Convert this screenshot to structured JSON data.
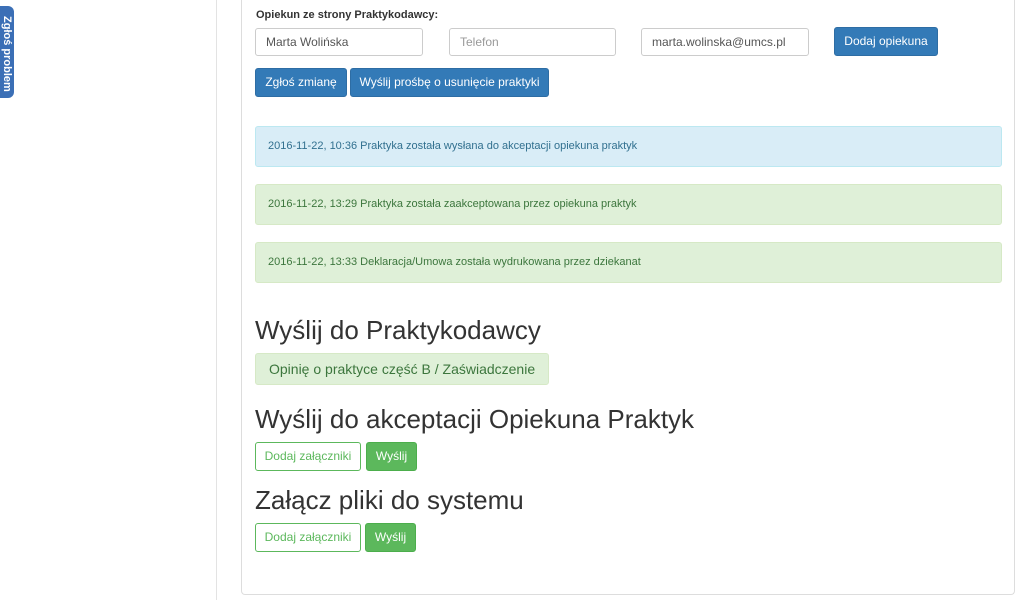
{
  "report_tab": {
    "label": "Zgłoś problem"
  },
  "guardian": {
    "label": "Opiekun ze strony Praktykodawcy:",
    "name_value": "Marta Wolińska",
    "phone_placeholder": "Telefon",
    "email_value": "marta.wolinska@umcs.pl",
    "add_button": "Dodaj opiekuna"
  },
  "actions": {
    "report_change": "Zgłoś zmianę",
    "request_removal": "Wyślij prośbę o usunięcie praktyki"
  },
  "history": [
    {
      "text": "2016-11-22, 10:36 Praktyka została wysłana do akceptacji opiekuna praktyk",
      "status": "info"
    },
    {
      "text": "2016-11-22, 13:29 Praktyka została zaakceptowana przez opiekuna praktyk",
      "status": "success"
    },
    {
      "text": "2016-11-22, 13:33 Deklaracja/Umowa została wydrukowana przez dziekanat",
      "status": "success"
    }
  ],
  "send_to_employer": {
    "heading": "Wyślij do Praktykodawcy",
    "document": "Opinię o praktyce część B / Zaświadczenie"
  },
  "send_for_acceptance": {
    "heading": "Wyślij do akceptacji Opiekuna Praktyk",
    "add_attachments": "Dodaj załączniki",
    "send": "Wyślij"
  },
  "attach_files": {
    "heading": "Załącz pliki do systemu",
    "add_attachments": "Dodaj załączniki",
    "send": "Wyślij"
  },
  "colors": {
    "primary": "#337ab7",
    "success": "#5cb85c",
    "info_bg": "#d9edf7",
    "success_bg": "#dff0d8",
    "report_tab": "#3b6fb6"
  }
}
